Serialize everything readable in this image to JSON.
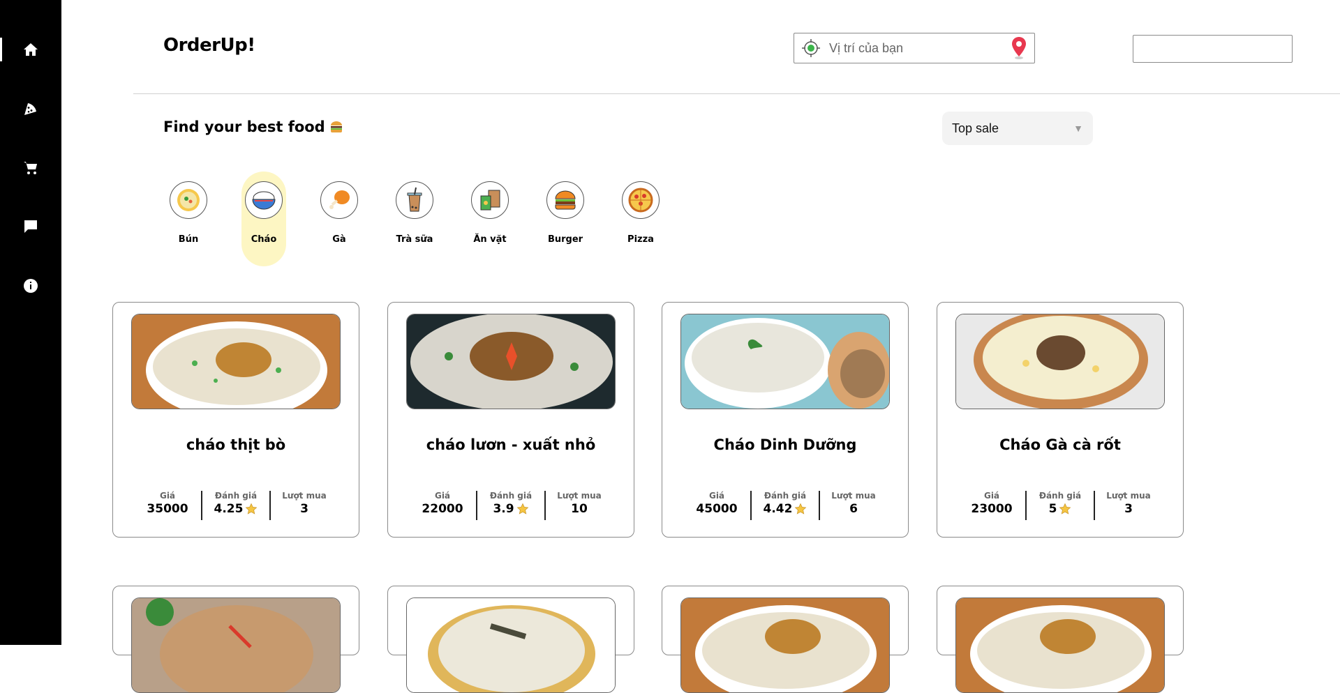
{
  "brand": "OrderUp!",
  "location": {
    "placeholder": "Vị trí của bạn"
  },
  "section_title": "Find your best food",
  "sort": {
    "selected": "Top sale"
  },
  "sidebar": {
    "items": [
      {
        "icon": "home-icon"
      },
      {
        "icon": "pizza-icon"
      },
      {
        "icon": "cart-icon"
      },
      {
        "icon": "chat-icon"
      },
      {
        "icon": "info-icon"
      }
    ]
  },
  "categories": [
    {
      "label": "Bún",
      "icon": "noodle-bowl-icon"
    },
    {
      "label": "Cháo",
      "icon": "rice-porridge-icon",
      "active": true
    },
    {
      "label": "Gà",
      "icon": "chicken-leg-icon"
    },
    {
      "label": "Trà sữa",
      "icon": "milk-tea-icon"
    },
    {
      "label": "Ăn vặt",
      "icon": "snack-icon"
    },
    {
      "label": "Burger",
      "icon": "burger-icon"
    },
    {
      "label": "Pizza",
      "icon": "pizza-icon"
    }
  ],
  "stat_labels": {
    "price": "Giá",
    "rating": "Đánh giá",
    "sold": "Lượt mua"
  },
  "products": [
    {
      "name": "cháo thịt bò",
      "price": "35000",
      "rating": "4.25",
      "sold": "3"
    },
    {
      "name": "cháo lươn - xuất nhỏ",
      "price": "22000",
      "rating": "3.9",
      "sold": "10"
    },
    {
      "name": "Cháo Dinh Dưỡng",
      "price": "45000",
      "rating": "4.42",
      "sold": "6"
    },
    {
      "name": "Cháo Gà cà rốt",
      "price": "23000",
      "rating": "5",
      "sold": "3"
    }
  ],
  "colors": {
    "sidebar": "#000000",
    "active_category": "#fdf6c3",
    "star": "#f5c542"
  }
}
